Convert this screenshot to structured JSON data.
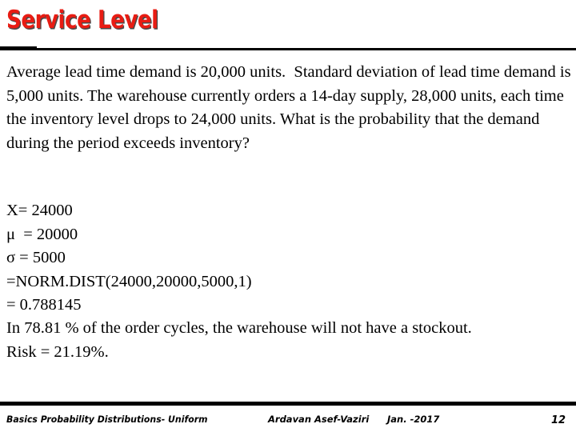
{
  "slide": {
    "title": "Service Level",
    "title_color": "#E81C13",
    "body_paragraph": "Average lead time demand is 20,000 units.  Standard deviation of lead time demand is 5,000 units. The warehouse currently orders a 14-day supply, 28,000 units, each time the inventory level drops to 24,000 units. What is the probability that the demand during the period exceeds inventory?",
    "calculation_lines": [
      "X= 24000",
      "μ  = 20000",
      "σ = 5000",
      "=NORM.DIST(24000,20000,5000,1)",
      "= 0.788145"
    ],
    "conclusion_lines": [
      "In 78.81 % of the order cycles, the warehouse will not have a stockout.",
      "Risk = 21.19%."
    ]
  },
  "footer": {
    "left_text": "Basics Probability Distributions- Uniform",
    "author": "Ardavan Asef-Vaziri",
    "date": "Jan. -2017",
    "page_number": "12"
  }
}
